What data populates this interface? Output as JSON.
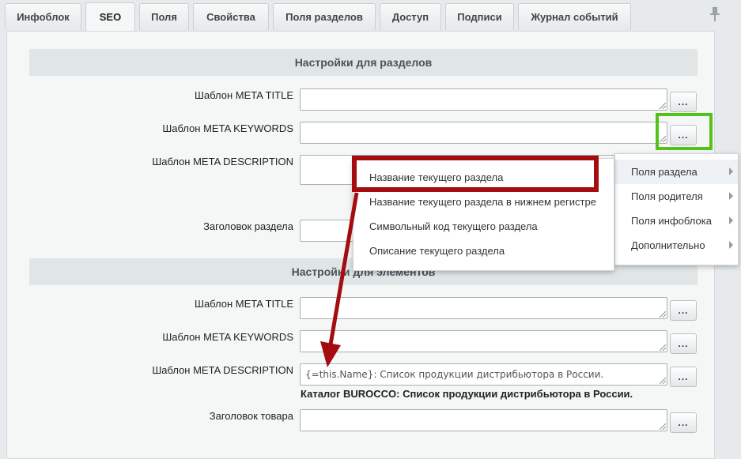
{
  "tabs": [
    {
      "label": "Инфоблок"
    },
    {
      "label": "SEO"
    },
    {
      "label": "Поля"
    },
    {
      "label": "Свойства"
    },
    {
      "label": "Поля разделов"
    },
    {
      "label": "Доступ"
    },
    {
      "label": "Подписи"
    },
    {
      "label": "Журнал событий"
    }
  ],
  "active_tab": "SEO",
  "sections": {
    "sections_title": "Настройки для разделов",
    "elements_title": "Настройки для элементов"
  },
  "section_fields": {
    "meta_title": {
      "label": "Шаблон META TITLE",
      "value": ""
    },
    "meta_keywords": {
      "label": "Шаблон META KEYWORDS",
      "value": ""
    },
    "meta_description": {
      "label": "Шаблон META DESCRIPTION",
      "value": ""
    },
    "heading": {
      "label": "Заголовок раздела",
      "value": ""
    }
  },
  "element_fields": {
    "meta_title": {
      "label": "Шаблон META TITLE",
      "value": ""
    },
    "meta_keywords": {
      "label": "Шаблон META KEYWORDS",
      "value": ""
    },
    "meta_description": {
      "label": "Шаблон META DESCRIPTION",
      "value": "{=this.Name}: Список продукции дистрибьютора в России."
    },
    "meta_description_preview": "Каталог BUROCCO: Список продукции дистрибьютора в России.",
    "heading": {
      "label": "Заголовок товара",
      "value": ""
    }
  },
  "insert_button_label": "...",
  "submenu": {
    "items": [
      {
        "label": "Поля раздела"
      },
      {
        "label": "Поля родителя"
      },
      {
        "label": "Поля инфоблока"
      },
      {
        "label": "Дополнительно"
      }
    ]
  },
  "menu": {
    "items": [
      {
        "label": "Название текущего раздела"
      },
      {
        "label": "Название текущего раздела в нижнем регистре"
      },
      {
        "label": "Символьный код текущего раздела"
      },
      {
        "label": "Описание текущего раздела"
      }
    ]
  },
  "colors": {
    "highlight_red": "#a40c10",
    "highlight_green": "#55c21c"
  },
  "icons": [
    "pin-icon",
    "submenu-arrow-icon",
    "resize-grip-icon",
    "annotation-arrow"
  ]
}
